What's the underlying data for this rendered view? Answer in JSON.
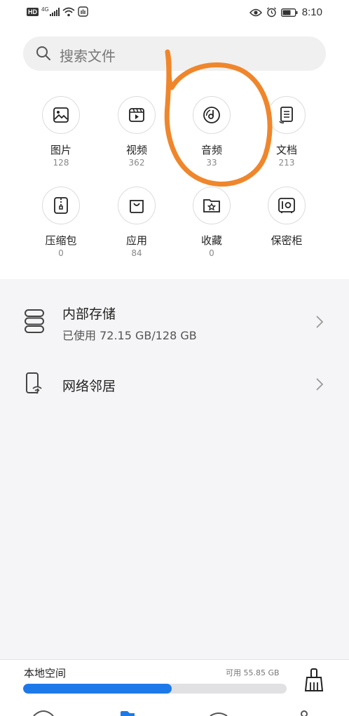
{
  "status_bar": {
    "hd_badge": "HD",
    "network": "4G",
    "time": "8:10"
  },
  "search": {
    "placeholder": "搜索文件"
  },
  "categories": [
    {
      "label": "图片",
      "count": "128",
      "icon": "image-icon"
    },
    {
      "label": "视频",
      "count": "362",
      "icon": "video-icon"
    },
    {
      "label": "音频",
      "count": "33",
      "icon": "audio-icon"
    },
    {
      "label": "文档",
      "count": "213",
      "icon": "document-icon"
    },
    {
      "label": "压缩包",
      "count": "0",
      "icon": "archive-icon"
    },
    {
      "label": "应用",
      "count": "84",
      "icon": "app-bag-icon"
    },
    {
      "label": "收藏",
      "count": "0",
      "icon": "star-folder-icon"
    },
    {
      "label": "保密柜",
      "count": "",
      "icon": "safe-icon"
    }
  ],
  "storage": {
    "internal_title": "内部存储",
    "internal_used": "已使用 72.15 GB/128 GB",
    "network_title": "网络邻居"
  },
  "bottom": {
    "label": "本地空间",
    "free": "可用 55.85 GB",
    "used_fraction": 0.5637
  },
  "colors": {
    "accent": "#1e79e8",
    "annotation": "#f0862b"
  }
}
